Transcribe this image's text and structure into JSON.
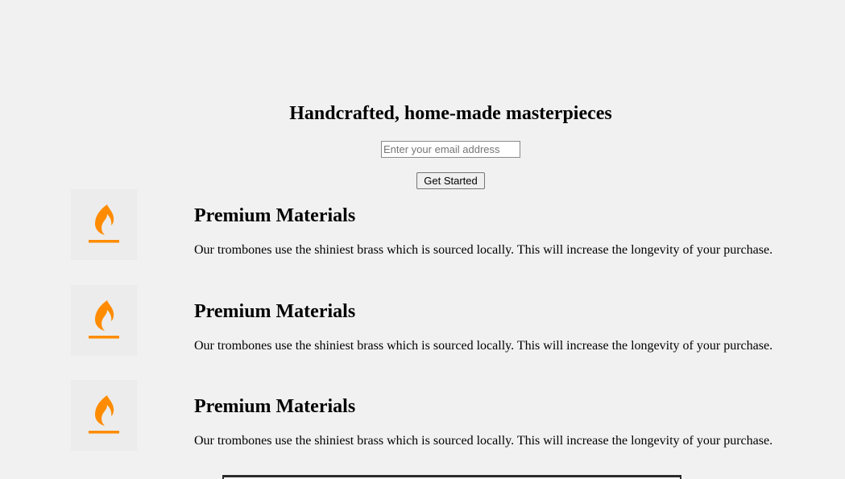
{
  "hero": {
    "title": "Handcrafted, home-made masterpieces",
    "email_placeholder": "Enter your email address",
    "email_value": "",
    "button_label": "Get Started"
  },
  "features": [
    {
      "icon": "flame-icon",
      "title": "Premium Materials",
      "description": "Our trombones use the shiniest brass which is sourced locally. This will increase the longevity of your purchase."
    },
    {
      "icon": "flame-icon",
      "title": "Premium Materials",
      "description": "Our trombones use the shiniest brass which is sourced locally. This will increase the longevity of your purchase."
    },
    {
      "icon": "flame-icon",
      "title": "Premium Materials",
      "description": "Our trombones use the shiniest brass which is sourced locally. This will increase the longevity of your purchase."
    }
  ],
  "colors": {
    "background": "#f1f1f1",
    "icon_accent": "#ff8c00",
    "icon_box": "#ececec"
  }
}
